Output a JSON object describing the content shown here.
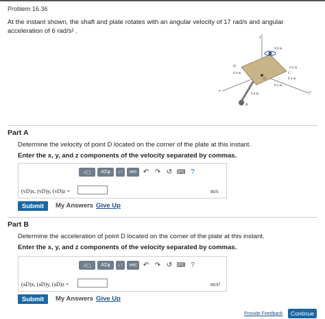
{
  "problem": {
    "title": "Problem 16.36",
    "text_line1": "At the instant shown, the shaft and plate rotates with an angular velocity of 17 rad/s and angular",
    "text_line2": "acceleration of 6 rad/s² ."
  },
  "figure": {
    "labels": [
      "z",
      "0.6 m",
      "D",
      "0.2 m",
      "0.4 m",
      "C",
      "O",
      "0.3 m",
      "0.3 m",
      "0.4 m",
      "y",
      "x",
      "B"
    ]
  },
  "partA": {
    "title": "Part A",
    "question": "Determine the velocity of point D located on the corner of the plate at this instant.",
    "instruction": "Enter the x, y, and z components of the velocity separated by commas.",
    "label": "(vD)x, (vD)y, (vD)z =",
    "unit": "m/s",
    "input_value": "",
    "submit": "Submit",
    "my_answers": "My Answers",
    "give_up": "Give Up"
  },
  "partB": {
    "title": "Part B",
    "question": "Determine the acceleration of point D located on the corner of the plate at this instant.",
    "instruction": "Enter the x, y, and z components of the velocity separated by commas.",
    "label": "(aD)x, (aD)y, (aD)z =",
    "unit": "m/s²",
    "input_value": "",
    "submit": "Submit",
    "my_answers": "My Answers",
    "give_up": "Give Up"
  },
  "toolbar": {
    "templates": "√▢",
    "greek": "AΣφ",
    "arrows": "↓↑",
    "vec": "vec",
    "undo": "↶",
    "redo": "↷",
    "reset": "↺",
    "keyboard": "⌨",
    "help": "?"
  },
  "footer": {
    "feedback": "Provide Feedback",
    "continue": "Continue"
  },
  "colors": {
    "primary_button": "#1a67a3",
    "link": "#1a4f8a",
    "toolbar_button": "#6f7d8c",
    "plate": "#c9b48a"
  }
}
